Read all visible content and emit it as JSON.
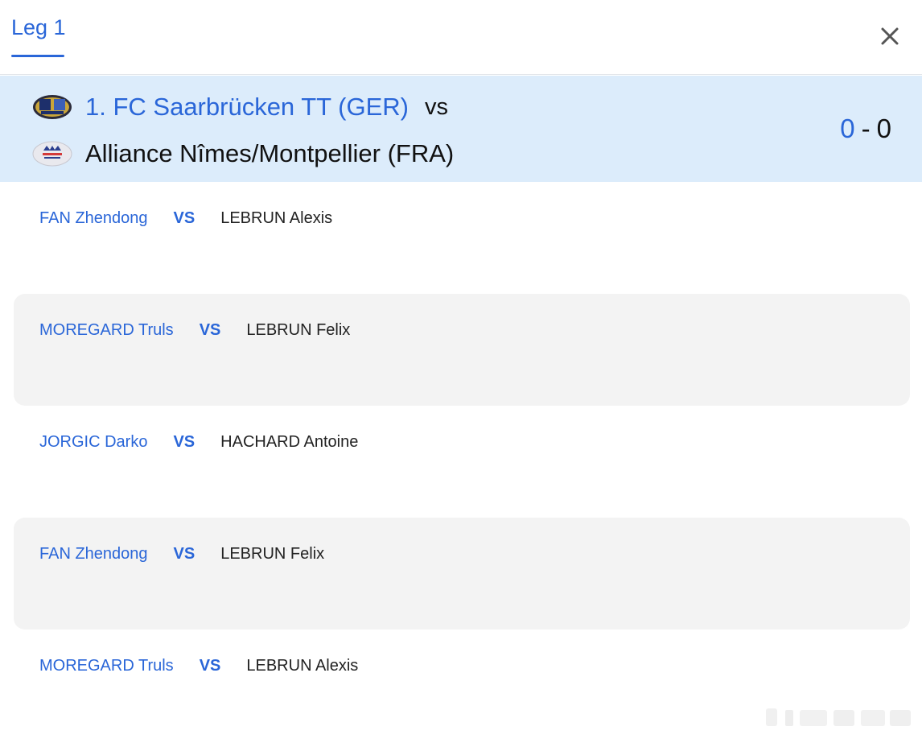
{
  "tab": {
    "label": "Leg 1"
  },
  "match": {
    "home_team": "1. FC Saarbrücken TT (GER)",
    "vs_label": "vs",
    "away_team": "Alliance Nîmes/Montpellier (FRA)",
    "score_home": "0",
    "score_separator": "-",
    "score_away": "0"
  },
  "games": [
    {
      "home_player": "FAN Zhendong",
      "vs": "VS",
      "away_player": "LEBRUN Alexis"
    },
    {
      "home_player": "MOREGARD Truls",
      "vs": "VS",
      "away_player": "LEBRUN Felix"
    },
    {
      "home_player": "JORGIC Darko",
      "vs": "VS",
      "away_player": "HACHARD Antoine"
    },
    {
      "home_player": "FAN Zhendong",
      "vs": "VS",
      "away_player": "LEBRUN Felix"
    },
    {
      "home_player": "MOREGARD Truls",
      "vs": "VS",
      "away_player": "LEBRUN Alexis"
    }
  ],
  "colors": {
    "accent": "#2a66d8",
    "banner_background": "#dcecfb",
    "row_shade": "#f3f3f3"
  },
  "icons": {
    "close": "close-icon",
    "home_logo": "saarbrucken-logo",
    "away_logo": "nimes-montpellier-logo"
  }
}
